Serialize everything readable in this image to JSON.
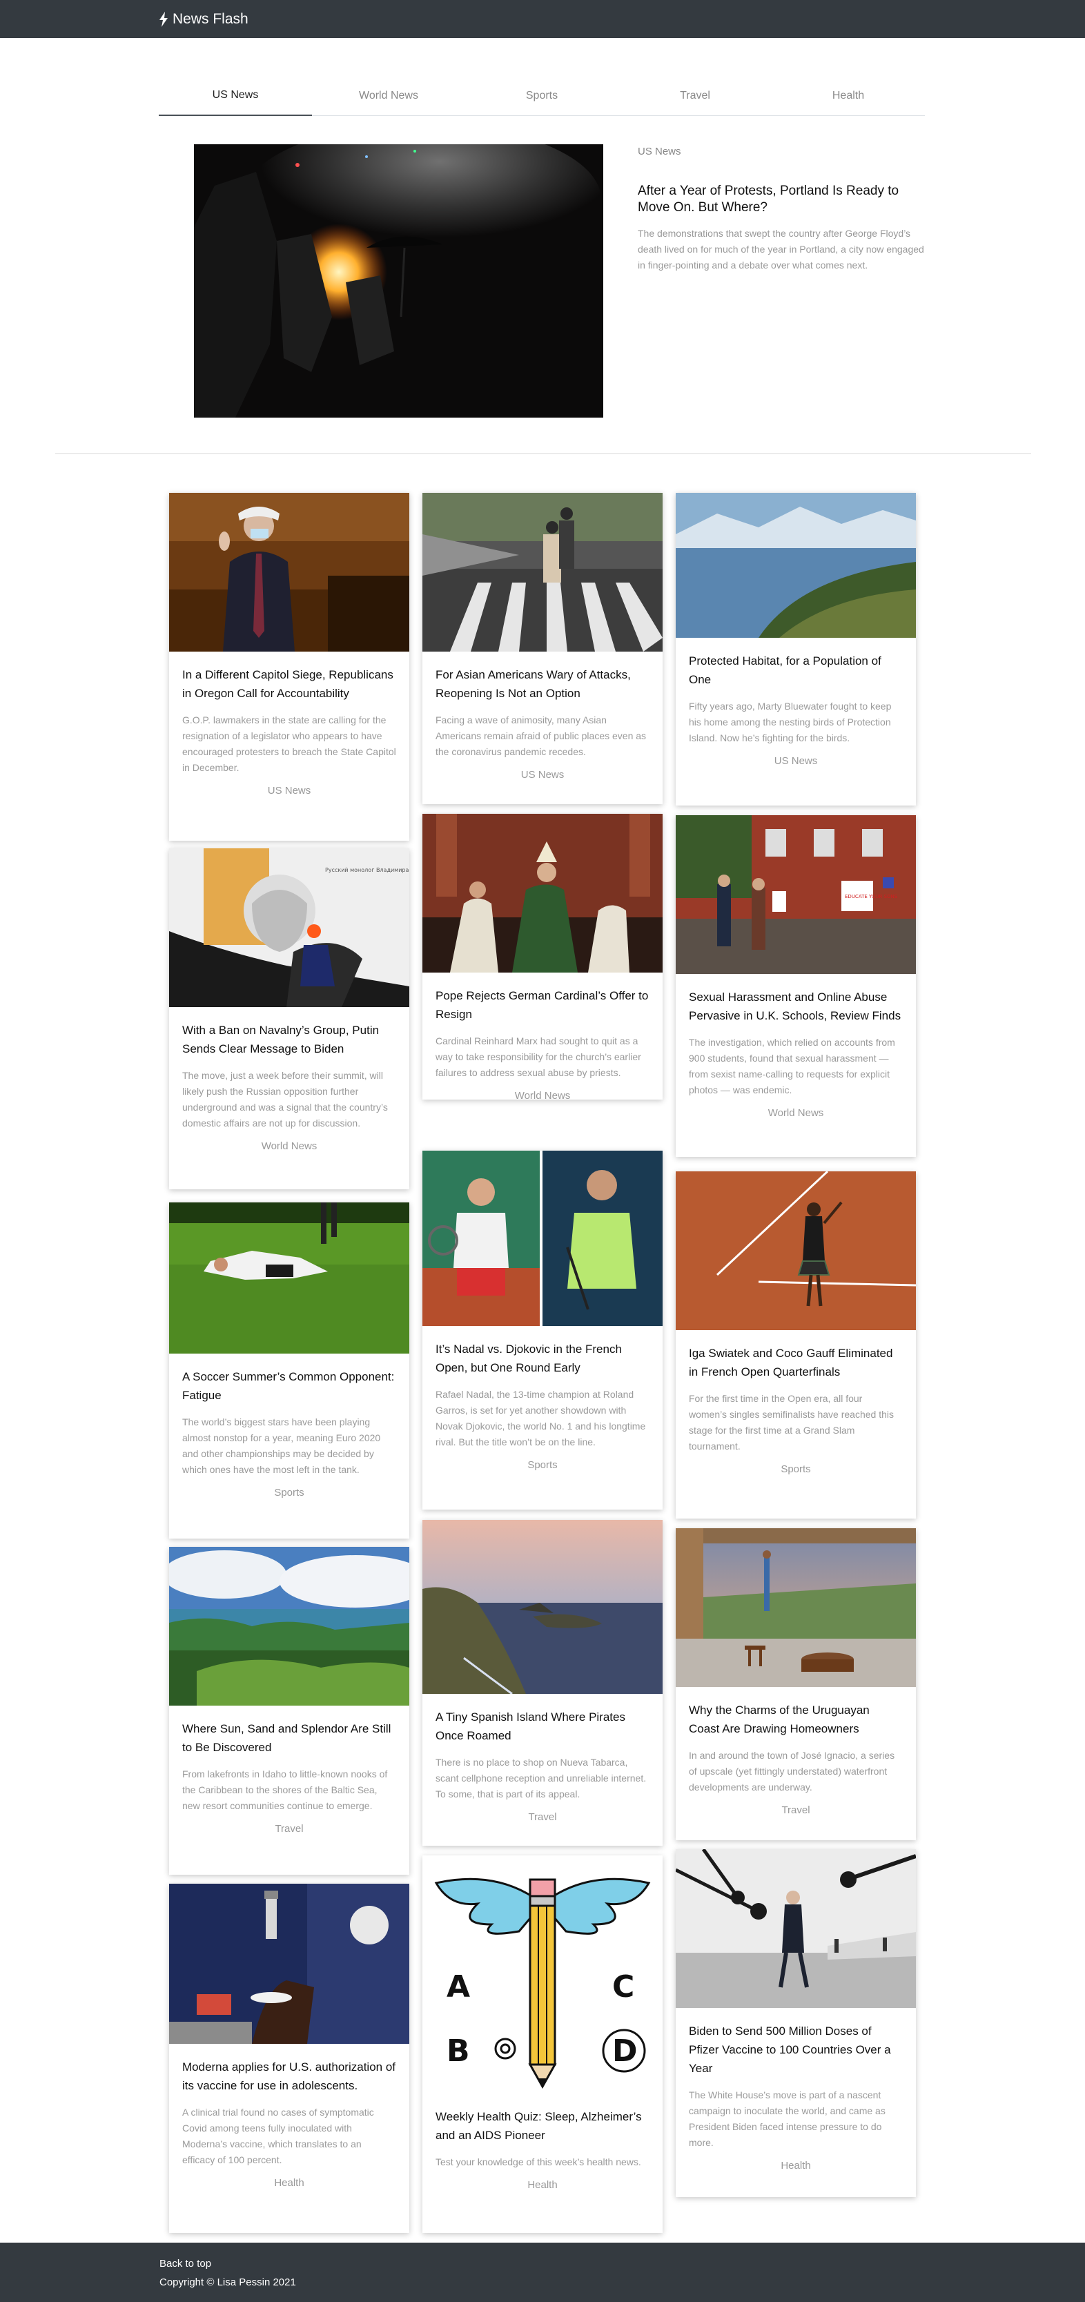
{
  "brand": {
    "name": "News Flash",
    "icon": "lightning-bolt-icon"
  },
  "tabs": [
    {
      "label": "US News",
      "active": true
    },
    {
      "label": "World News",
      "active": false
    },
    {
      "label": "Sports",
      "active": false
    },
    {
      "label": "Travel",
      "active": false
    },
    {
      "label": "Health",
      "active": false
    }
  ],
  "hero": {
    "category": "US News",
    "title": "After a Year of Protests, Portland Is Ready to Move On. But Where?",
    "description": "The demonstrations that swept the country after George Floyd’s death lived on for much of the year in Portland, a city now engaged in finger-pointing and a debate over what comes next."
  },
  "articles": [
    {
      "title": "In a Different Capitol Siege, Republicans in Oregon Call for Accountability",
      "description": "G.O.P. lawmakers in the state are calling for the resignation of a legislator who appears to have encouraged protesters to breach the State Capitol in December.",
      "category": "US News"
    },
    {
      "title": "For Asian Americans Wary of Attacks, Reopening Is Not an Option",
      "description": "Facing a wave of animosity, many Asian Americans remain afraid of public places even as the coronavirus pandemic recedes.",
      "category": "US News"
    },
    {
      "title": "Protected Habitat, for a Population of One",
      "description": "Fifty years ago, Marty Bluewater fought to keep his home among the nesting birds of Protection Island. Now he’s fighting for the birds.",
      "category": "US News"
    },
    {
      "title": "With a Ban on Navalny’s Group, Putin Sends Clear Message to Biden",
      "description": "The move, just a week before their summit, will likely push the Russian opposition further underground and was a signal that the country’s domestic affairs are not up for discussion.",
      "category": "World News"
    },
    {
      "title": "Pope Rejects German Cardinal’s Offer to Resign",
      "description": "Cardinal Reinhard Marx had sought to quit as a way to take responsibility for the church’s earlier failures to address sexual abuse by priests.",
      "category": "World News"
    },
    {
      "title": "Sexual Harassment and Online Abuse Pervasive in U.K. Schools, Review Finds",
      "description": "The investigation, which relied on accounts from 900 students, found that sexual harassment — from sexist name-calling to requests for explicit photos — was endemic.",
      "category": "World News"
    },
    {
      "title": "A Soccer Summer’s Common Opponent: Fatigue",
      "description": "The world’s biggest stars have been playing almost nonstop for a year, meaning Euro 2020 and other championships may be decided by which ones have the most left in the tank.",
      "category": "Sports"
    },
    {
      "title": "It’s Nadal vs. Djokovic in the French Open, but One Round Early",
      "description": "Rafael Nadal, the 13-time champion at Roland Garros, is set for yet another showdown with Novak Djokovic, the world No. 1 and his longtime rival. But the title won’t be on the line.",
      "category": "Sports"
    },
    {
      "title": "Iga Swiatek and Coco Gauff Eliminated in French Open Quarterfinals",
      "description": "For the first time in the Open era, all four women’s singles semifinalists have reached this stage for the first time at a Grand Slam tournament.",
      "category": "Sports"
    },
    {
      "title": "Where Sun, Sand and Splendor Are Still to Be Discovered",
      "description": "From lakefronts in Idaho to little-known nooks of the Caribbean to the shores of the Baltic Sea, new resort communities continue to emerge.",
      "category": "Travel"
    },
    {
      "title": "A Tiny Spanish Island Where Pirates Once Roamed",
      "description": "There is no place to shop on Nueva Tabarca, scant cellphone reception and unreliable internet. To some, that is part of its appeal.",
      "category": "Travel"
    },
    {
      "title": "Why the Charms of the Uruguayan Coast Are Drawing Homeowners",
      "description": "In and around the town of José Ignacio, a series of upscale (yet fittingly understated) waterfront developments are underway.",
      "category": "Travel"
    },
    {
      "title": "Moderna applies for U.S. authorization of its vaccine for use in adolescents.",
      "description": "A clinical trial found no cases of symptomatic Covid among teens fully inoculated with Moderna’s vaccine, which translates to an efficacy of 100 percent.",
      "category": "Health"
    },
    {
      "title": "Weekly Health Quiz: Sleep, Alzheimer’s and an AIDS Pioneer",
      "description": "Test your knowledge of this week’s health news.",
      "category": "Health",
      "quiz_letters": [
        "A",
        "B",
        "C",
        "D"
      ]
    },
    {
      "title": "Biden to Send 500 Million Doses of Pfizer Vaccine to 100 Countries Over a Year",
      "description": "The White House’s move is part of a nascent campaign to inoculate the world, and came as President Biden faced intense pressure to do more.",
      "category": "Health"
    }
  ],
  "overlay_text": {
    "putin_banner": "Русский монолог Владимира",
    "protest_sign": "EDUCATE YOUR SONS"
  },
  "footer": {
    "back_to_top": "Back to top",
    "copyright": "Copyright © Lisa Pessin 2021"
  }
}
